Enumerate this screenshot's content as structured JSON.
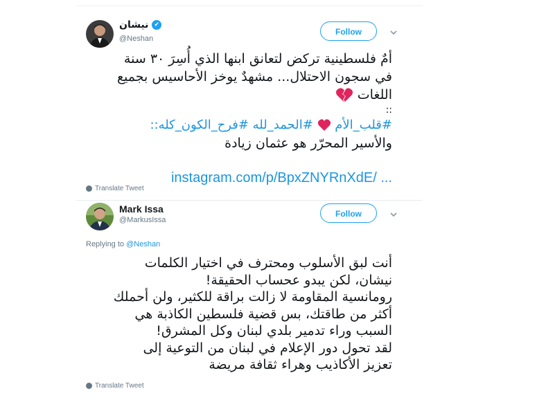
{
  "tweets": [
    {
      "author_name": "نيشان",
      "handle": "@Neshan",
      "verified_glyph": "✔",
      "follow_label": "Follow",
      "body_lines": [
        "أمٌ فلسطينية تركض لتعانق ابنها الذي أُسِرَ ٣٠ سنة",
        "في سجون الاحتلال... مشهدٌ يوخز الأحاسيس بجميع",
        "اللغات"
      ],
      "separator": "::",
      "hashtags": "#قلب_الأم ❤️ #الحمد_لله #فرح_الكون_كله::",
      "hashtag_parts": [
        "#قلب_الأم",
        "#الحمد_لله #فرح_الكون_كله::"
      ],
      "freed_line": "والأسير المحرّر هو عثمان زيادة",
      "link": "instagram.com/p/BpxZNYRnXdE/ ...",
      "translate_label": "Translate Tweet",
      "icons": {
        "heart_red": "heart-icon",
        "broken_heart": "broken-heart-icon",
        "globe": "globe-icon",
        "chevron": "chevron-down-icon"
      }
    },
    {
      "author_name": "Mark Issa",
      "handle": "@MarkusIssa",
      "follow_label": "Follow",
      "replying_prefix": "Replying to",
      "replying_to": "@Neshan",
      "body_lines": [
        "أنت لبق الأسلوب ومحترف في اختيار الكلمات",
        "نيشان، لكن يبدو عحساب الحقيقة!",
        "رومانسية المقاومة لا زالت براقة للكثير، ولن أحملك",
        "أكثر من طاقتك، بس قضية فلسطين الكاذبة هي",
        "السبب وراء تدمير بلدي لبنان وكل المشرق!",
        "لقد تحول دور الإعلام في لبنان من التوعية إلى",
        "تعزيز الأكاذيب وهراء ثقافة مريضة"
      ],
      "translate_label": "Translate Tweet"
    }
  ],
  "colors": {
    "accent": "#1da1f2",
    "link": "#1b95e0",
    "heart": "#e0245e",
    "muted": "#657786"
  }
}
